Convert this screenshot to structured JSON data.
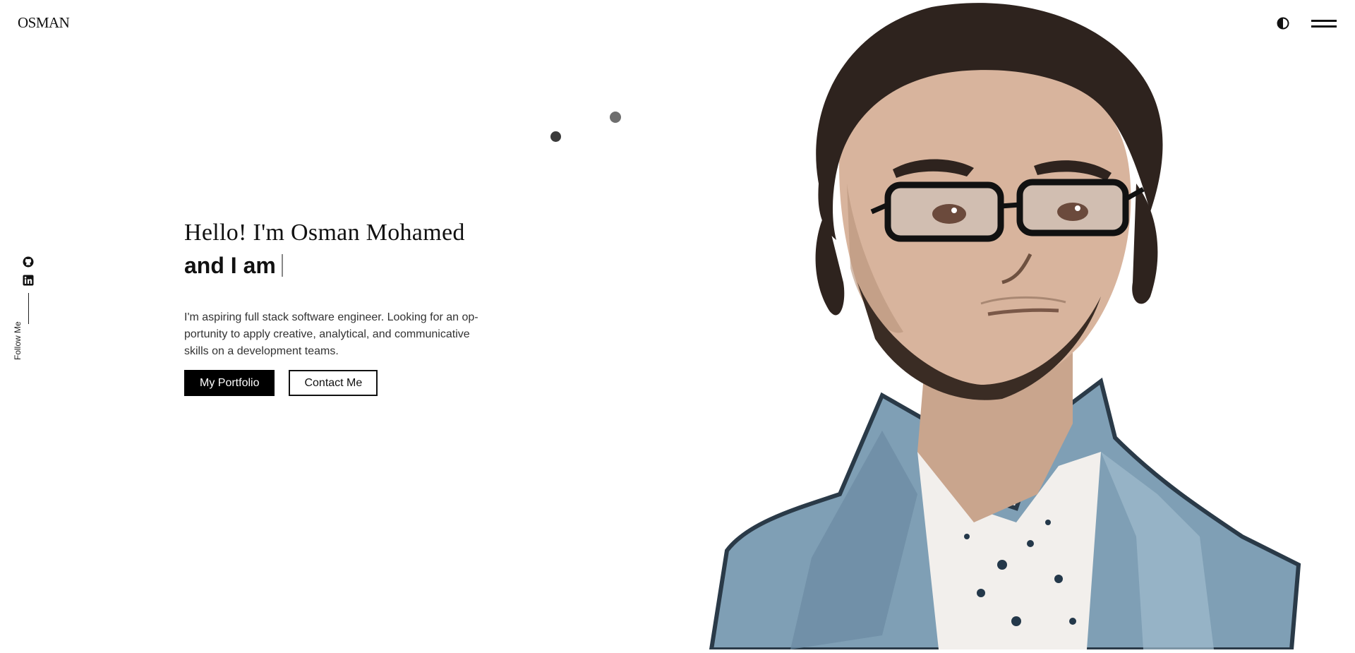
{
  "header": {
    "logo": "OSMAN",
    "theme_toggle_icon": "half-circle-icon",
    "menu_icon": "hamburger-menu-icon"
  },
  "social": {
    "links": [
      {
        "icon": "github-icon"
      },
      {
        "icon": "linkedin-icon"
      }
    ],
    "label": "Follow Me"
  },
  "hero": {
    "greeting": "Hello! I'm Osman Mohamed",
    "typed_prefix": "and I am",
    "description": "I'm aspiring full stack software engineer. Looking for an op- portunity to apply creative, analytical, and communicative skills on a development teams.",
    "primary_button": "My Portfolio",
    "secondary_button": "Contact Me"
  },
  "colors": {
    "primary": "#000000",
    "background": "#ffffff",
    "dot_dark": "#3a3a3a",
    "dot_light": "#6e6e6e"
  }
}
